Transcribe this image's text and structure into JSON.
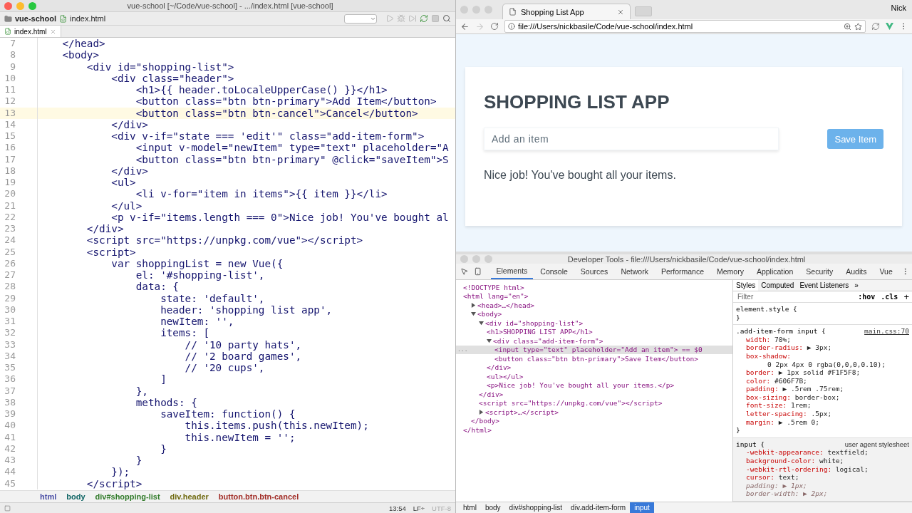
{
  "editor": {
    "title": "vue-school [~/Code/vue-school] - .../index.html [vue-school]",
    "breadcrumb": [
      "vue-school",
      "index.html"
    ],
    "tab": {
      "label": "index.html",
      "selected": true
    },
    "lines": [
      {
        "number": "7",
        "text": "    </head>",
        "current": false
      },
      {
        "number": "8",
        "text": "    <body>",
        "current": false
      },
      {
        "number": "9",
        "text": "        <div id=\"shopping-list\">",
        "current": false
      },
      {
        "number": "10",
        "text": "            <div class=\"header\">",
        "current": false
      },
      {
        "number": "11",
        "text": "                <h1>{{ header.toLocaleUpperCase() }}</h1>",
        "current": false
      },
      {
        "number": "12",
        "text": "                <button class=\"btn btn-primary\">Add Item</button>",
        "current": false
      },
      {
        "number": "13",
        "text": "                <button class=\"btn btn-cancel\">Cancel</button>",
        "current": true
      },
      {
        "number": "14",
        "text": "            </div>",
        "current": false
      },
      {
        "number": "15",
        "text": "            <div v-if=\"state === 'edit'\" class=\"add-item-form\">",
        "current": false
      },
      {
        "number": "16",
        "text": "                <input v-model=\"newItem\" type=\"text\" placeholder=\"A",
        "current": false
      },
      {
        "number": "17",
        "text": "                <button class=\"btn btn-primary\" @click=\"saveItem\">S",
        "current": false
      },
      {
        "number": "18",
        "text": "            </div>",
        "current": false
      },
      {
        "number": "19",
        "text": "            <ul>",
        "current": false
      },
      {
        "number": "20",
        "text": "                <li v-for=\"item in items\">{{ item }}</li>",
        "current": false
      },
      {
        "number": "21",
        "text": "            </ul>",
        "current": false
      },
      {
        "number": "22",
        "text": "            <p v-if=\"items.length === 0\">Nice job! You've bought al",
        "current": false
      },
      {
        "number": "23",
        "text": "        </div>",
        "current": false
      },
      {
        "number": "24",
        "text": "        <script src=\"https://unpkg.com/vue\"></script>",
        "current": false
      },
      {
        "number": "25",
        "text": "        <script>",
        "current": false
      },
      {
        "number": "26",
        "text": "            var shoppingList = new Vue({",
        "current": false
      },
      {
        "number": "27",
        "text": "                el: '#shopping-list',",
        "current": false
      },
      {
        "number": "28",
        "text": "                data: {",
        "current": false
      },
      {
        "number": "29",
        "text": "                    state: 'default',",
        "current": false
      },
      {
        "number": "30",
        "text": "                    header: 'shopping list app',",
        "current": false
      },
      {
        "number": "31",
        "text": "                    newItem: '',",
        "current": false
      },
      {
        "number": "32",
        "text": "                    items: [",
        "current": false
      },
      {
        "number": "33",
        "text": "                        // '10 party hats',",
        "current": false
      },
      {
        "number": "34",
        "text": "                        // '2 board games',",
        "current": false
      },
      {
        "number": "35",
        "text": "                        // '20 cups',",
        "current": false
      },
      {
        "number": "36",
        "text": "                    ]",
        "current": false
      },
      {
        "number": "37",
        "text": "                },",
        "current": false
      },
      {
        "number": "38",
        "text": "                methods: {",
        "current": false
      },
      {
        "number": "39",
        "text": "                    saveItem: function() {",
        "current": false
      },
      {
        "number": "40",
        "text": "                        this.items.push(this.newItem);",
        "current": false
      },
      {
        "number": "41",
        "text": "                        this.newItem = '';",
        "current": false
      },
      {
        "number": "42",
        "text": "                    }",
        "current": false
      },
      {
        "number": "43",
        "text": "                }",
        "current": false
      },
      {
        "number": "44",
        "text": "            });",
        "current": false
      },
      {
        "number": "45",
        "text": "        </script>",
        "current": false
      }
    ],
    "path": [
      {
        "label": "html",
        "color": "#4b4fa6"
      },
      {
        "label": "body",
        "color": "#0e6464"
      },
      {
        "label": "div#shopping-list",
        "color": "#2f7a28"
      },
      {
        "label": "div.header",
        "color": "#6f6a10"
      },
      {
        "label": "button.btn.btn-cancel",
        "color": "#a02a24"
      }
    ],
    "status": {
      "position": "13:54",
      "line_ending": "LF÷",
      "encoding": "UTF-8"
    }
  },
  "browser": {
    "tab": {
      "title": "Shopping List App",
      "selected": true
    },
    "user": "Nick",
    "url": "file:///Users/nickbasile/Code/vue-school/index.html",
    "page": {
      "heading": "SHOPPING LIST APP",
      "input": {
        "placeholder": "Add an item"
      },
      "button": "Save Item",
      "message": "Nice job! You've bought all your items."
    }
  },
  "devtools": {
    "title": "Developer Tools - file:///Users/nickbasile/Code/vue-school/index.html",
    "tabs": [
      {
        "label": "Elements",
        "selected": true
      },
      {
        "label": "Console",
        "selected": false
      },
      {
        "label": "Sources",
        "selected": false
      },
      {
        "label": "Network",
        "selected": false
      },
      {
        "label": "Performance",
        "selected": false
      },
      {
        "label": "Memory",
        "selected": false
      },
      {
        "label": "Application",
        "selected": false
      },
      {
        "label": "Security",
        "selected": false
      },
      {
        "label": "Audits",
        "selected": false
      },
      {
        "label": "Vue",
        "selected": false
      }
    ],
    "tree": [
      {
        "text": "<!DOCTYPE html>",
        "selected": false
      },
      {
        "text": "<html lang=\"en\">",
        "selected": false,
        "children": [
          {
            "text": "<head>…</head>",
            "selected": false,
            "expanded": false
          },
          {
            "text": "<body>",
            "selected": false,
            "expanded": true,
            "children": [
              {
                "text": "<div id=\"shopping-list\">",
                "selected": false,
                "expanded": true,
                "children": [
                  {
                    "text": "<h1>SHOPPING LIST APP</h1>",
                    "selected": false
                  },
                  {
                    "text": "<div class=\"add-item-form\">",
                    "selected": false,
                    "expanded": true,
                    "children": [
                      {
                        "text": "<input type=\"text\" placeholder=\"Add an item\"> == $0",
                        "selected": true,
                        "marker": "..."
                      },
                      {
                        "text": "<button class=\"btn btn-primary\">Save Item</button>",
                        "selected": false
                      }
                    ]
                  },
                  {
                    "text": "</div>",
                    "selected": false
                  },
                  {
                    "text": "<ul></ul>",
                    "selected": false
                  },
                  {
                    "text": "<p>Nice job! You've bought all your items.</p>",
                    "selected": false
                  }
                ]
              },
              {
                "text": "</div>",
                "selected": false
              },
              {
                "text": "<script src=\"https://unpkg.com/vue\"></script>",
                "selected": false
              },
              {
                "text": "<script>…</script>",
                "selected": false,
                "expanded": false
              }
            ]
          },
          {
            "text": "</body>",
            "selected": false
          }
        ]
      },
      {
        "text": "</html>",
        "selected": false
      }
    ],
    "side_tabs": [
      {
        "label": "Styles",
        "selected": true
      },
      {
        "label": "Computed",
        "selected": false
      },
      {
        "label": "Event Listeners",
        "selected": false
      },
      {
        "label": "»",
        "selected": false
      }
    ],
    "filter": {
      "placeholder": "Filter",
      "hov": ":hov",
      "cls": ".cls",
      "add": "+"
    },
    "rules": [
      {
        "kind": "inline",
        "selector": "element.style {",
        "close": "}"
      },
      {
        "kind": "author",
        "selector": ".add-item-form input {",
        "source": "main.css:70",
        "close": "}",
        "decls": [
          {
            "prop": "width:",
            "value": "70%;",
            "struck": false
          },
          {
            "prop": "border-radius:",
            "value": "▶ 3px;",
            "struck": false
          },
          {
            "prop": "box-shadow:",
            "value_line": "0 2px 4px 0 rgba(0,0,0,0.10);",
            "struck": false
          },
          {
            "prop": "border:",
            "value": "▶ 1px solid #F1F5F8;",
            "struck": false
          },
          {
            "prop": "color:",
            "value": "#606F7B;",
            "struck": false
          },
          {
            "prop": "padding:",
            "value": "▶ .5rem .75rem;",
            "struck": false
          },
          {
            "prop": "box-sizing:",
            "value": "border-box;",
            "struck": false
          },
          {
            "prop": "font-size:",
            "value": "1rem;",
            "struck": false
          },
          {
            "prop": "letter-spacing:",
            "value": ".5px;",
            "struck": false
          },
          {
            "prop": "margin:",
            "value": "▶ .5rem 0;",
            "struck": false
          }
        ]
      },
      {
        "kind": "agent",
        "selector": "input {",
        "source": "user agent stylesheet",
        "decls": [
          {
            "prop": "-webkit-appearance:",
            "value": "textfield;",
            "struck": false
          },
          {
            "prop": "background-color:",
            "value": "white;",
            "struck": false
          },
          {
            "prop": "-webkit-rtl-ordering:",
            "value": "logical;",
            "struck": false
          },
          {
            "prop": "cursor:",
            "value": "text;",
            "struck": false
          },
          {
            "prop": "padding:",
            "value": "▶ 1px;",
            "struck": true
          },
          {
            "prop": "border-width:",
            "value": "▶ 2px;",
            "struck": true
          }
        ]
      }
    ],
    "path": [
      {
        "label": "html",
        "selected": false
      },
      {
        "label": "body",
        "selected": false
      },
      {
        "label": "div#shopping-list",
        "selected": false
      },
      {
        "label": "div.add-item-form",
        "selected": false
      },
      {
        "label": "input",
        "selected": true
      }
    ]
  }
}
